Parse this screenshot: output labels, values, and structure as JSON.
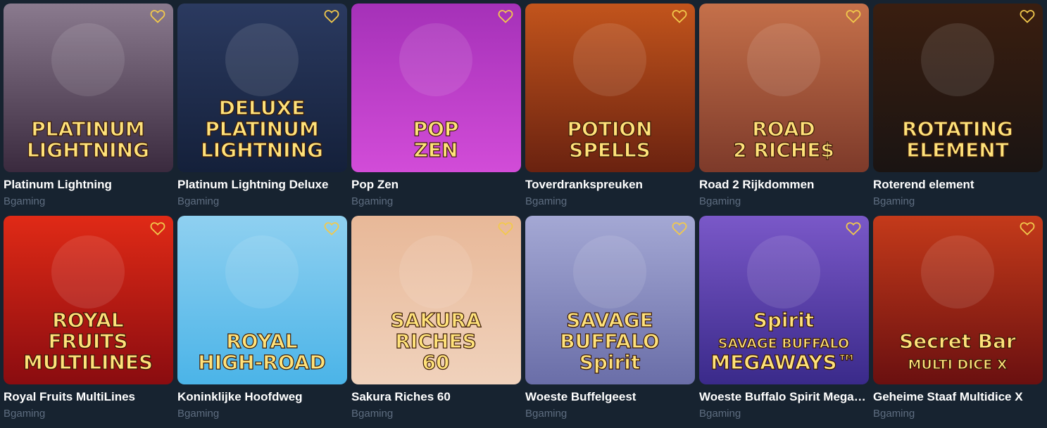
{
  "games": [
    {
      "title": "Platinum Lightning",
      "provider": "Bgaming",
      "art_lines": [
        "PLATINUM",
        "LIGHTNING"
      ],
      "colors": [
        "#3a2a3e",
        "#8a7a8e"
      ]
    },
    {
      "title": "Platinum Lightning Deluxe",
      "provider": "Bgaming",
      "art_lines": [
        "DELUXE",
        "PLATINUM",
        "LIGHTNING"
      ],
      "colors": [
        "#14203a",
        "#2b3a60"
      ]
    },
    {
      "title": "Pop Zen",
      "provider": "Bgaming",
      "art_lines": [
        "POP",
        "ZEN"
      ],
      "colors": [
        "#d24cd8",
        "#a531b8"
      ]
    },
    {
      "title": "Toverdrankspreuken",
      "provider": "Bgaming",
      "art_lines": [
        "POTION",
        "SPELLS"
      ],
      "colors": [
        "#6a2210",
        "#c2541c"
      ]
    },
    {
      "title": "Road 2 Rijkdommen",
      "provider": "Bgaming",
      "art_lines": [
        "ROAD",
        "2 RICHE$"
      ],
      "colors": [
        "#7d3a2a",
        "#c5704a"
      ]
    },
    {
      "title": "Roterend element",
      "provider": "Bgaming",
      "art_lines": [
        "ROTATING",
        "ELEMENT"
      ],
      "colors": [
        "#1a1412",
        "#3a1e10"
      ]
    },
    {
      "title": "Royal Fruits MultiLines",
      "provider": "Bgaming",
      "art_lines": [
        "ROYAL",
        "FRUITS",
        "MULTILINES"
      ],
      "colors": [
        "#8a0c10",
        "#e02a16"
      ]
    },
    {
      "title": "Koninklijke Hoofdweg",
      "provider": "Bgaming",
      "art_lines": [
        "ROYAL",
        "HIGH-ROAD"
      ],
      "colors": [
        "#4bb4e8",
        "#8fd0f0"
      ]
    },
    {
      "title": "Sakura Riches 60",
      "provider": "Bgaming",
      "art_lines": [
        "SAKURA",
        "RICHES",
        "60"
      ],
      "colors": [
        "#f0d2bc",
        "#e8b898"
      ]
    },
    {
      "title": "Woeste Buffelgeest",
      "provider": "Bgaming",
      "art_lines": [
        "SAVAGE",
        "BUFFALO",
        "Spirit"
      ],
      "colors": [
        "#6a6ea8",
        "#a4a8d4"
      ]
    },
    {
      "title": "Woeste Buffalo Spirit Megaways",
      "provider": "Bgaming",
      "art_lines": [
        "Spirit",
        "SAVAGE BUFFALO",
        "MEGAWAYS™"
      ],
      "colors": [
        "#3a2a8a",
        "#7a58c8"
      ]
    },
    {
      "title": "Geheime Staaf Multidice X",
      "provider": "Bgaming",
      "art_lines": [
        "Secret Bar",
        "MULTI DICE X"
      ],
      "colors": [
        "#6a1010",
        "#c43a1a"
      ]
    }
  ],
  "icons": {
    "favorite": "heart-outline-icon",
    "favorite_color": "#f2c94c"
  }
}
